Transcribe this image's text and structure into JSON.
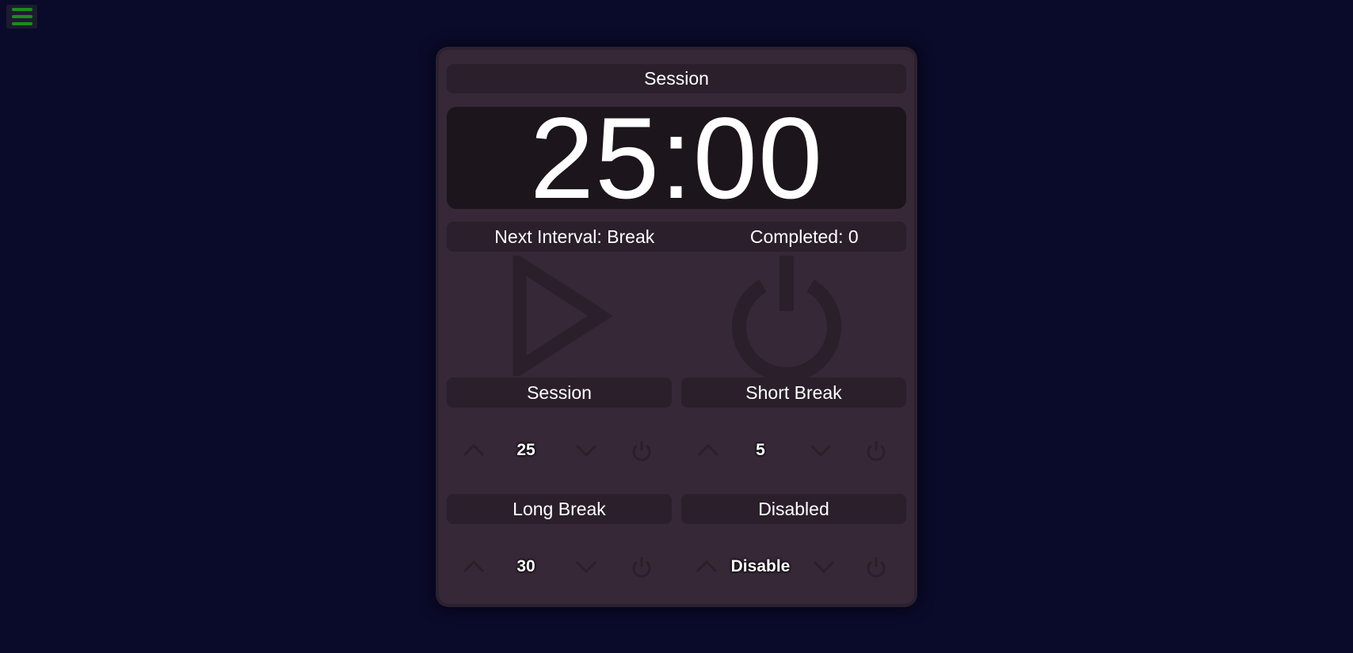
{
  "menu": {
    "icon": "hamburger-menu-icon",
    "color": "#1e8a1e"
  },
  "timer": {
    "mode_label": "Session",
    "time": "25:00",
    "next_interval": "Next Interval: Break",
    "completed": "Completed: 0",
    "start_icon": "play-icon",
    "power_icon": "power-icon"
  },
  "settings": {
    "session": {
      "label": "Session",
      "value": "25"
    },
    "short_break": {
      "label": "Short Break",
      "value": "5"
    },
    "long_break": {
      "label": "Long Break",
      "value": "30"
    },
    "disabled": {
      "label": "Disabled",
      "value": "Disable"
    }
  },
  "colors": {
    "page_bg": "#0a0a2a",
    "panel_bg": "#362836",
    "pill_bg": "#2a1f2b",
    "clock_bg": "#1c151c",
    "icon_color": "#2a1f2b"
  }
}
